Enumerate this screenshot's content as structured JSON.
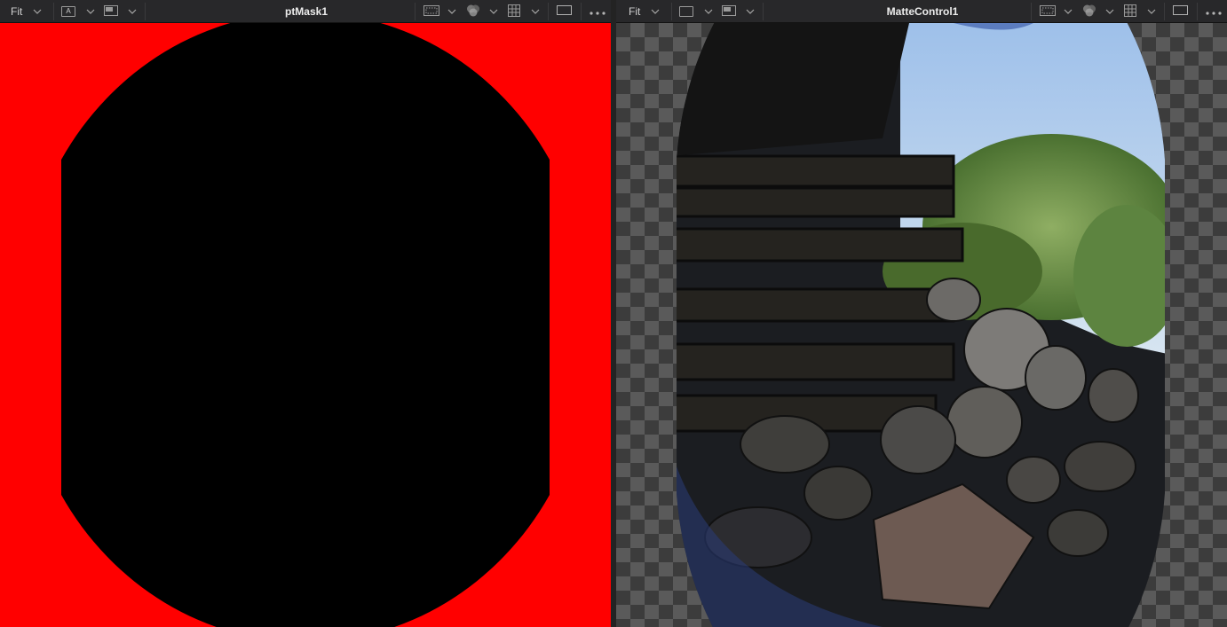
{
  "left_viewer": {
    "fit_label": "Fit",
    "channel_label": "A",
    "title": "ptMask1"
  },
  "right_viewer": {
    "fit_label": "Fit",
    "title": "MatteControl1"
  },
  "colors": {
    "toolbar_bg": "#28282a",
    "mask_background": "#ff0000",
    "mask_shape": "#000000",
    "checker_dark": "#3c3c3c",
    "checker_light": "#5a5a5a"
  },
  "icons": [
    "chevron-down-icon",
    "channel-a-icon",
    "display-mode-icon",
    "roi-icon",
    "color-wheels-icon",
    "grid-icon",
    "frame-icon",
    "more-options-icon"
  ]
}
